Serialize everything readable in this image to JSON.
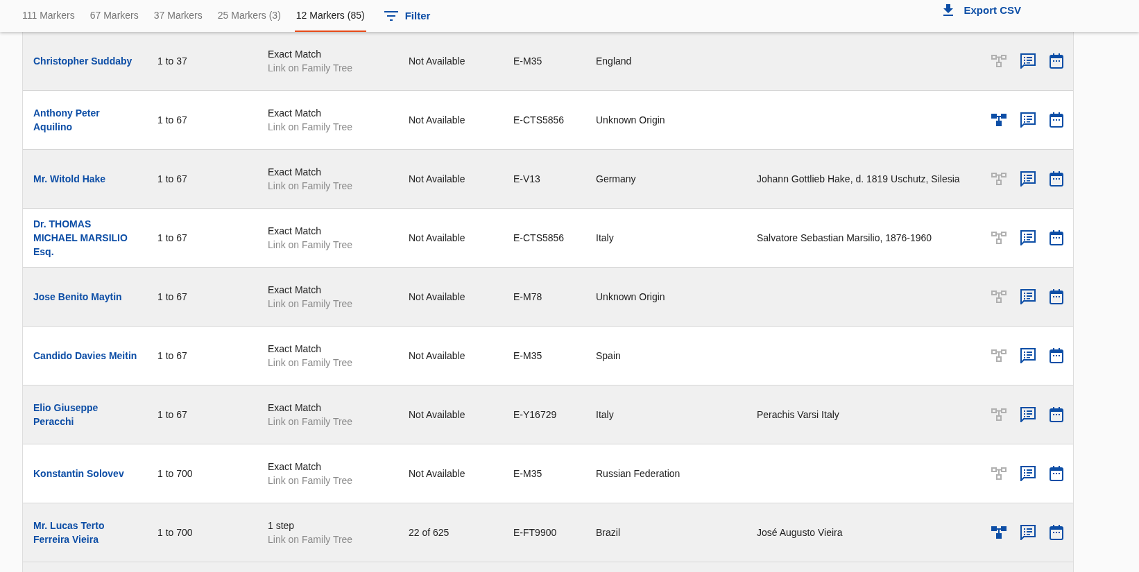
{
  "tabs": [
    {
      "label": "111 Markers",
      "selected": false
    },
    {
      "label": "67 Markers",
      "selected": false
    },
    {
      "label": "37 Markers",
      "selected": false
    },
    {
      "label": "25 Markers (3)",
      "selected": false
    },
    {
      "label": "12 Markers (85)",
      "selected": true
    }
  ],
  "filter": {
    "label": "Filter"
  },
  "export": {
    "label": "Export CSV"
  },
  "rows": [
    {
      "name": "Christopher Suddaby",
      "range": "1 to 37",
      "match": "Exact Match",
      "tree_link": "Link on Family Tree",
      "column_4": "Not Available",
      "haplogroup": "E-M35",
      "origin": "England",
      "ancestor": "",
      "on_tree": false
    },
    {
      "name": "Anthony Peter Aquilino",
      "range": "1 to 67",
      "match": "Exact Match",
      "tree_link": "Link on Family Tree",
      "column_4": "Not Available",
      "haplogroup": "E-CTS5856",
      "origin": "Unknown Origin",
      "ancestor": "",
      "on_tree": true
    },
    {
      "name": "Mr. Witold Hake",
      "range": "1 to 67",
      "match": "Exact Match",
      "tree_link": "Link on Family Tree",
      "column_4": "Not Available",
      "haplogroup": "E-V13",
      "origin": "Germany",
      "ancestor": "Johann Gottlieb Hake, d. 1819 Uschutz, Silesia",
      "on_tree": false
    },
    {
      "name": "Dr. THOMAS MICHAEL MARSILIO Esq.",
      "range": "1 to 67",
      "match": "Exact Match",
      "tree_link": "Link on Family Tree",
      "column_4": "Not Available",
      "haplogroup": "E-CTS5856",
      "origin": "Italy",
      "ancestor": "Salvatore Sebastian Marsilio, 1876-1960",
      "on_tree": false
    },
    {
      "name": "Jose Benito Maytin",
      "range": "1 to 67",
      "match": "Exact Match",
      "tree_link": "Link on Family Tree",
      "column_4": "Not Available",
      "haplogroup": "E-M78",
      "origin": "Unknown Origin",
      "ancestor": "",
      "on_tree": false
    },
    {
      "name": "Candido Davies Meitin",
      "range": "1 to 67",
      "match": "Exact Match",
      "tree_link": "Link on Family Tree",
      "column_4": "Not Available",
      "haplogroup": "E-M35",
      "origin": "Spain",
      "ancestor": "",
      "on_tree": false
    },
    {
      "name": "Elio Giuseppe Peracchi",
      "range": "1 to 67",
      "match": "Exact Match",
      "tree_link": "Link on Family Tree",
      "column_4": "Not Available",
      "haplogroup": "E-Y16729",
      "origin": "Italy",
      "ancestor": "Perachis Varsi Italy",
      "on_tree": false
    },
    {
      "name": "Konstantin Solovev",
      "range": "1 to 700",
      "match": "Exact Match",
      "tree_link": "Link on Family Tree",
      "column_4": "Not Available",
      "haplogroup": "E-M35",
      "origin": "Russian Federation",
      "ancestor": "",
      "on_tree": false
    },
    {
      "name": "Mr. Lucas Terto Ferreira Vieira",
      "range": "1 to 700",
      "match": "1 step",
      "tree_link": "Link on Family Tree",
      "column_4": "22 of 625",
      "haplogroup": "E-FT9900",
      "origin": "Brazil",
      "ancestor": "José Augusto Vieira",
      "on_tree": true
    }
  ]
}
